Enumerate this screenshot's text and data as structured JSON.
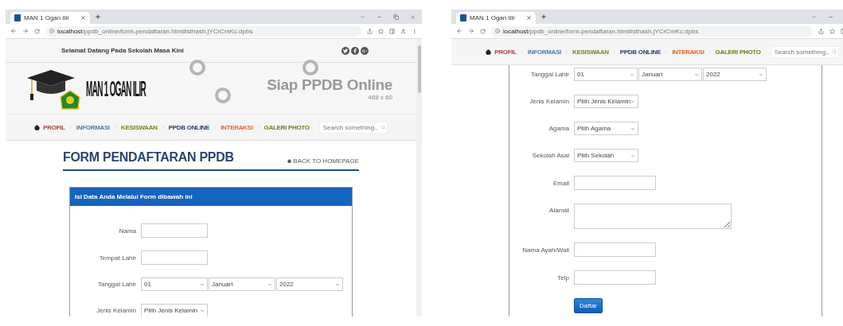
{
  "windows": [
    {
      "tab": {
        "title": "MAN 1 Ogan Ilir"
      },
      "url_host": "localhost",
      "url_path": "/ppdb_online/form-pendaftaran.html#sthash.jYCrCmKc.dpbs",
      "header": {
        "greeting": "Selamat Datang Pada Sekolah Masa Kini",
        "school": "MAN 1 OGAN ILIR",
        "banner": "Siap PPDB Online",
        "banner_size": "468 x 60"
      },
      "nav": [
        {
          "label": "PROFIL",
          "color": "#a8473a",
          "dropdown": true
        },
        {
          "label": "INFORMASI",
          "color": "#4a7ea6",
          "dropdown": true
        },
        {
          "label": "KESISWAAN",
          "color": "#6f8a1e",
          "dropdown": true
        },
        {
          "label": "PPDB ONLINE",
          "color": "#2b3f6b",
          "dropdown": true
        },
        {
          "label": "INTERAKSI",
          "color": "#e8622a",
          "dropdown": true
        },
        {
          "label": "GALERI PHOTO",
          "color": "#6a8420",
          "dropdown": false
        }
      ],
      "search": {
        "placeholder": "Search something.."
      },
      "page_title": "FORM PENDAFTARAN PPDB",
      "back_link": "BACK TO HOMEPAGE",
      "panel_heading": "Isi Data Anda Melalui Form dibawah ini",
      "fields": [
        {
          "kind": "text",
          "label": "Nama"
        },
        {
          "kind": "text",
          "label": "Tempat Lahir"
        },
        {
          "kind": "date",
          "label": "Tanggal Lahir",
          "values": [
            "01",
            "Januari",
            "2022"
          ]
        },
        {
          "kind": "select",
          "label": "Jenis Kelamin",
          "value": "Pilih Jenis Kelamin"
        }
      ]
    },
    {
      "tab": {
        "title": "MAN 1 Ogan Ilir"
      },
      "url_host": "localhost",
      "url_path": "/ppdb_online/form-pendaftaran.html#sthash.jYCrCmKc.dpbs",
      "nav": [
        {
          "label": "PROFIL",
          "color": "#a8473a",
          "dropdown": true
        },
        {
          "label": "INFORMASI",
          "color": "#4a7ea6",
          "dropdown": true
        },
        {
          "label": "KESISWAAN",
          "color": "#6f8a1e",
          "dropdown": true
        },
        {
          "label": "PPDB ONLINE",
          "color": "#2b3f6b",
          "dropdown": true
        },
        {
          "label": "INTERAKSI",
          "color": "#e8622a",
          "dropdown": true
        },
        {
          "label": "GALERI PHOTO",
          "color": "#6a8420",
          "dropdown": false
        }
      ],
      "search": {
        "placeholder": "Search something.."
      },
      "fields": [
        {
          "kind": "date",
          "label": "Tanggal Lahir",
          "values": [
            "01",
            "Januari",
            "2022"
          ]
        },
        {
          "kind": "select",
          "label": "Jenis Kelamin",
          "value": "Pilih Jenis Kelamin"
        },
        {
          "kind": "select",
          "label": "Agama",
          "value": "Pilih Agama"
        },
        {
          "kind": "select",
          "label": "Sekolah Asal",
          "value": "Pilih Sekolah"
        },
        {
          "kind": "text",
          "label": "Email"
        },
        {
          "kind": "textarea",
          "label": "Alamat"
        },
        {
          "kind": "text",
          "label": "Nama Ayah/Wali"
        },
        {
          "kind": "text",
          "label": "Telp"
        },
        {
          "kind": "button",
          "label": "Daftar"
        }
      ]
    }
  ]
}
